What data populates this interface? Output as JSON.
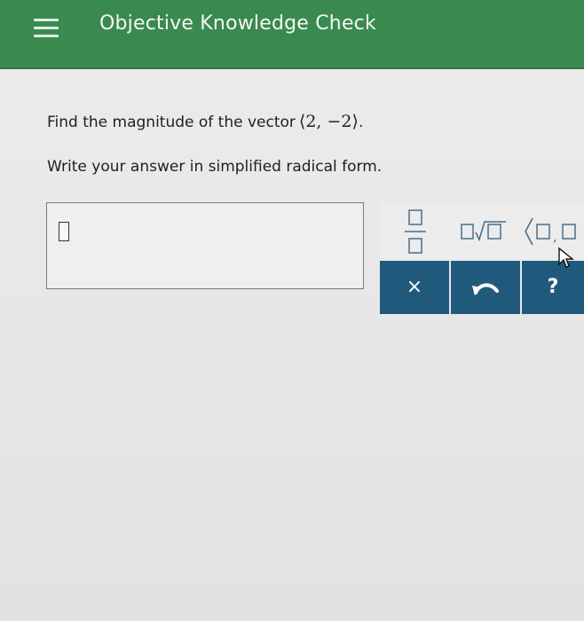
{
  "header": {
    "title": "Objective Knowledge Check",
    "bg_color": "#3a8a4f",
    "menu_icon": "hamburger-menu-icon"
  },
  "question": {
    "text": "Find the magnitude of the vector",
    "vector": "⟨2, −2⟩",
    "period": "."
  },
  "instruction": "Write your answer in simplified radical form.",
  "answer": {
    "value": ""
  },
  "keypad": {
    "top_row": [
      "fraction-template",
      "radical-template",
      "vector-template"
    ],
    "bottom_row": {
      "clear_label": "×",
      "undo_icon": "undo-icon",
      "help_label": "?"
    },
    "key_color": "#1f5a7c"
  }
}
